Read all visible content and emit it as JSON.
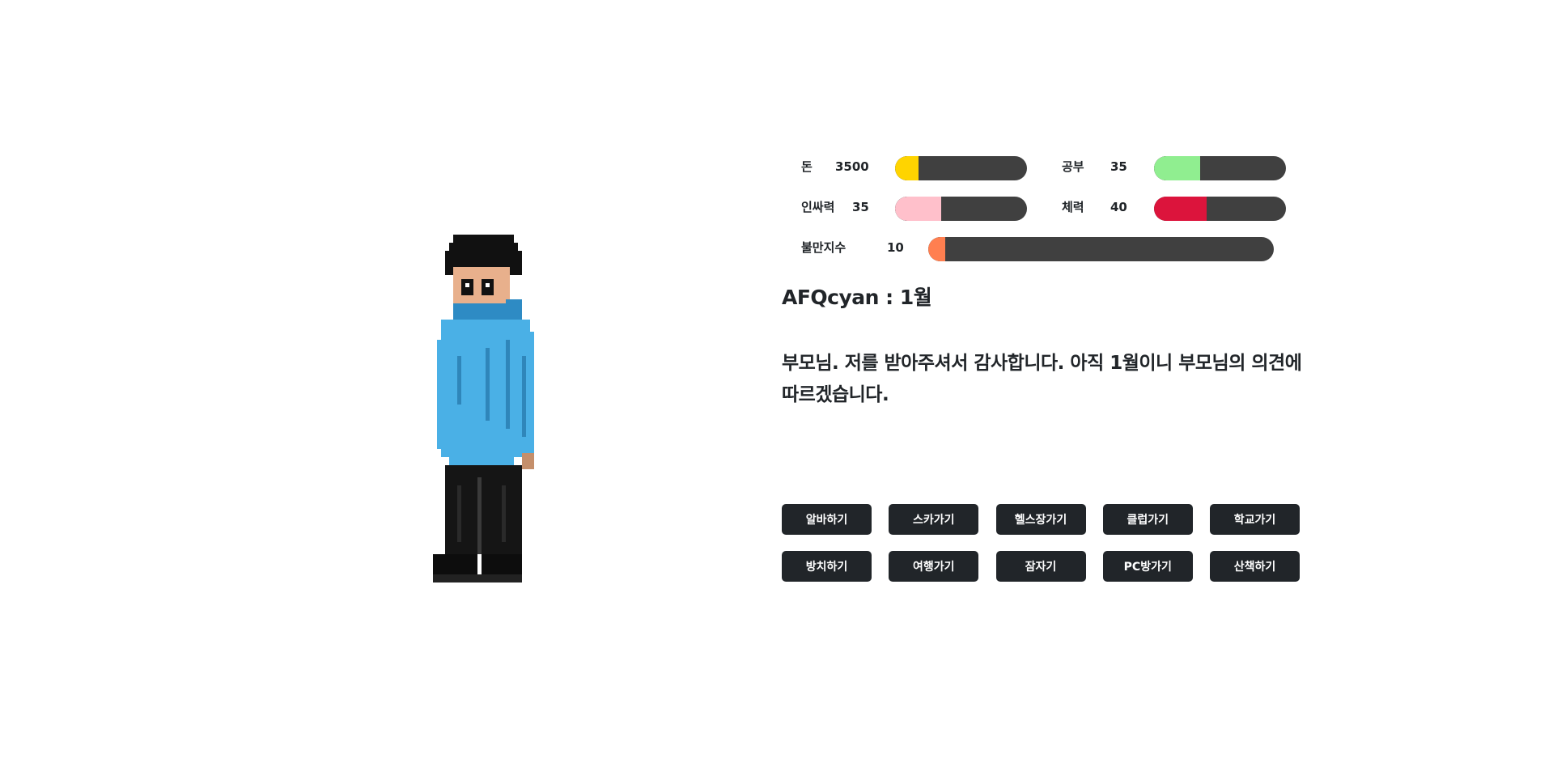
{
  "stats": {
    "money": {
      "label": "돈",
      "value": "3500",
      "fraction": 0.18,
      "color": "#ffd400"
    },
    "study": {
      "label": "공부",
      "value": "35",
      "fraction": 0.35,
      "color": "#90ee90"
    },
    "charm": {
      "label": "인싸력",
      "value": "35",
      "fraction": 0.35,
      "color": "#ffc0cb"
    },
    "stamina": {
      "label": "체력",
      "value": "40",
      "fraction": 0.4,
      "color": "#dc143c"
    },
    "discontent": {
      "label": "불만지수",
      "value": "10",
      "fraction": 0.05,
      "color": "#ff7f50"
    }
  },
  "headline": "AFQcyan : 1월",
  "message": "부모님. 저를 받아주셔서 감사합니다. 아직 1월이니 부모님의 의견에 따르겠습니다.",
  "actions": {
    "row1": [
      "알바하기",
      "스카가기",
      "헬스장가기",
      "클럽가기",
      "학교가기"
    ],
    "row2": [
      "방치하기",
      "여행가기",
      "잠자기",
      "PC방가기",
      "산책하기"
    ]
  },
  "character": {
    "icon": "pixel-student-sprite",
    "colors": {
      "hair": "#111111",
      "skin": "#e8b08c",
      "hoodie": "#4ab0e6",
      "pants": "#151515"
    }
  }
}
